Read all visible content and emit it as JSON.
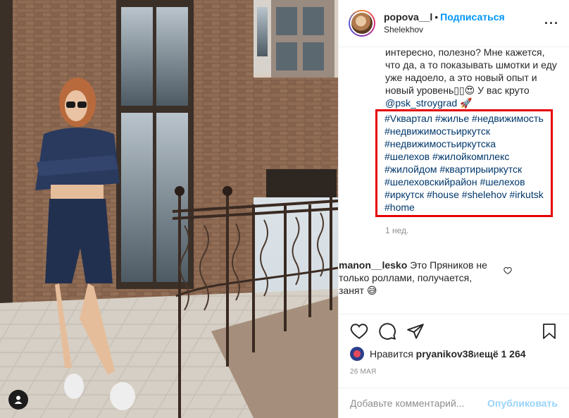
{
  "post": {
    "username": "popova__l",
    "separator": "•",
    "follow_label": "Подписаться",
    "location": "Shelekhov",
    "more_icon": "more-icon"
  },
  "caption": {
    "line1": "интересно, полезно? Мне кажется, что да, а то показывать шмотки и еду уже надоело, а это новый опыт и новый уровень",
    "emojis": "▯▯😍",
    "line2": " У вас круто ",
    "mention": "@psk_stroygrad",
    "rocket": "🚀",
    "hashtags": [
      "#Vквартал",
      "#жилье",
      "#недвижимость",
      "#недвижимостьиркутск",
      "#недвижимостьиркутска",
      "#шелехов",
      "#жилойкомплекс",
      "#жилойдом",
      "#квартирыиркутск",
      "#шелеховскийрайон",
      "#шелехов",
      "#иркутск",
      "#house",
      "#shelehov",
      "#irkutsk",
      "#home"
    ],
    "time": "1 нед."
  },
  "comment": {
    "username": "manon__lesko",
    "text": " Это Пряников не только роллами, получается, занят ",
    "emoji": "😅"
  },
  "likes": {
    "prefix": "Нравится ",
    "user": "pryanikov38",
    "middle": " и ",
    "count": "ещё 1 264"
  },
  "date": "26 мая",
  "add_comment": {
    "placeholder": "Добавьте комментарий...",
    "publish_label": "Опубликовать"
  },
  "colors": {
    "link": "#00376b",
    "follow": "#0095f6",
    "highlight": "#e60000"
  }
}
